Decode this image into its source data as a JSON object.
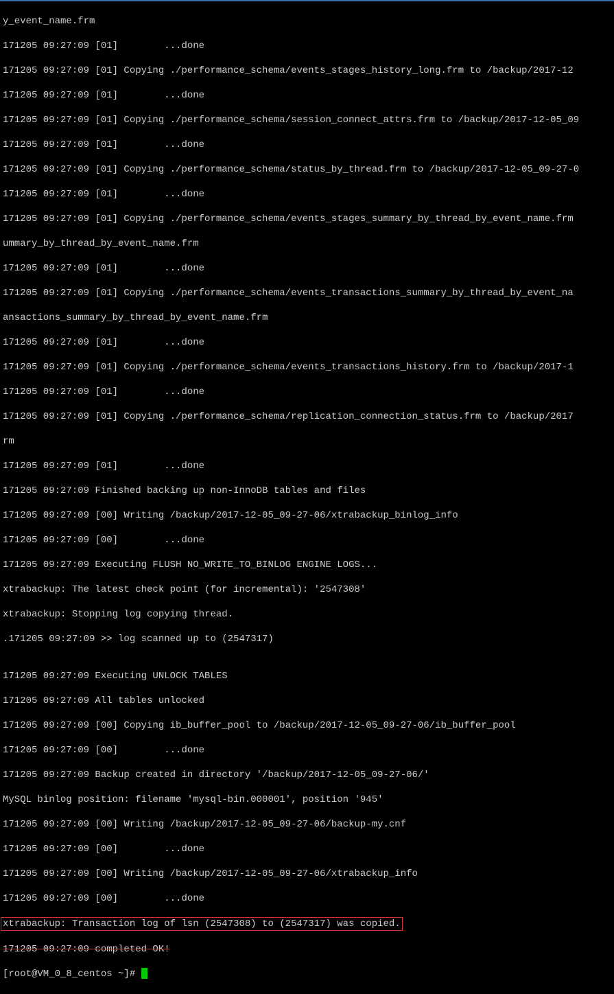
{
  "lines": {
    "l0": "y_event_name.frm",
    "l1": "171205 09:27:09 [01]        ...done",
    "l2": "171205 09:27:09 [01] Copying ./performance_schema/events_stages_history_long.frm to /backup/2017-12",
    "l3": "171205 09:27:09 [01]        ...done",
    "l4": "171205 09:27:09 [01] Copying ./performance_schema/session_connect_attrs.frm to /backup/2017-12-05_09",
    "l5": "171205 09:27:09 [01]        ...done",
    "l6": "171205 09:27:09 [01] Copying ./performance_schema/status_by_thread.frm to /backup/2017-12-05_09-27-0",
    "l7": "171205 09:27:09 [01]        ...done",
    "l8": "171205 09:27:09 [01] Copying ./performance_schema/events_stages_summary_by_thread_by_event_name.frm",
    "l9": "ummary_by_thread_by_event_name.frm",
    "l10": "171205 09:27:09 [01]        ...done",
    "l11": "171205 09:27:09 [01] Copying ./performance_schema/events_transactions_summary_by_thread_by_event_na",
    "l12": "ansactions_summary_by_thread_by_event_name.frm",
    "l13": "171205 09:27:09 [01]        ...done",
    "l14": "171205 09:27:09 [01] Copying ./performance_schema/events_transactions_history.frm to /backup/2017-1",
    "l15": "171205 09:27:09 [01]        ...done",
    "l16": "171205 09:27:09 [01] Copying ./performance_schema/replication_connection_status.frm to /backup/2017",
    "l17": "rm",
    "l18": "171205 09:27:09 [01]        ...done",
    "l19": "171205 09:27:09 Finished backing up non-InnoDB tables and files",
    "l20": "171205 09:27:09 [00] Writing /backup/2017-12-05_09-27-06/xtrabackup_binlog_info",
    "l21": "171205 09:27:09 [00]        ...done",
    "l22": "171205 09:27:09 Executing FLUSH NO_WRITE_TO_BINLOG ENGINE LOGS...",
    "l23": "xtrabackup: The latest check point (for incremental): '2547308'",
    "l24": "xtrabackup: Stopping log copying thread.",
    "l25": ".171205 09:27:09 >> log scanned up to (2547317)",
    "l26": "",
    "l27": "171205 09:27:09 Executing UNLOCK TABLES",
    "l28": "171205 09:27:09 All tables unlocked",
    "l29": "171205 09:27:09 [00] Copying ib_buffer_pool to /backup/2017-12-05_09-27-06/ib_buffer_pool",
    "l30": "171205 09:27:09 [00]        ...done",
    "l31": "171205 09:27:09 Backup created in directory '/backup/2017-12-05_09-27-06/'",
    "l32": "MySQL binlog position: filename 'mysql-bin.000001', position '945'",
    "l33": "171205 09:27:09 [00] Writing /backup/2017-12-05_09-27-06/backup-my.cnf",
    "l34": "171205 09:27:09 [00]        ...done",
    "l35": "171205 09:27:09 [00] Writing /backup/2017-12-05_09-27-06/xtrabackup_info",
    "l36": "171205 09:27:09 [00]        ...done",
    "l37": "xtrabackup: Transaction log of lsn (2547308) to (2547317) was copied.",
    "l38": "171205 09:27:09 completed OK!",
    "prompt": "[root@VM_0_8_centos ~]# "
  }
}
